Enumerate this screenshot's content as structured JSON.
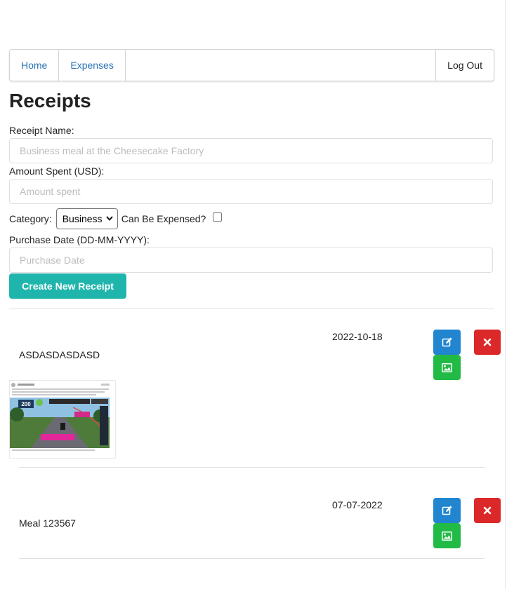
{
  "nav": {
    "home": "Home",
    "expenses": "Expenses",
    "logout": "Log Out"
  },
  "page_title": "Receipts",
  "form": {
    "receipt_name_label": "Receipt Name:",
    "receipt_name_placeholder": "Business meal at the Cheesecake Factory",
    "amount_label": "Amount Spent (USD):",
    "amount_placeholder": "Amount spent",
    "category_label": "Category:",
    "category_value": "Business",
    "expensable_label": "Can Be Expensed?",
    "expensable_checked": false,
    "date_label": "Purchase Date (DD-MM-YYYY):",
    "date_placeholder": "Purchase Date",
    "create_button": "Create New Receipt"
  },
  "receipts": [
    {
      "name": "ASDASDASDASD",
      "date": "2022-10-18",
      "has_image": true
    },
    {
      "name": "Meal 123567",
      "date": "07-07-2022",
      "has_image": false
    }
  ],
  "thumbnail": {
    "badge": "200"
  },
  "icons": {
    "edit": "edit-icon",
    "delete": "close-icon",
    "image": "image-icon"
  },
  "colors": {
    "primary_teal": "#1fb5ac",
    "edit_blue": "#2185d0",
    "delete_red": "#db2828",
    "image_green": "#21ba45",
    "link_blue": "#2a73b6"
  }
}
